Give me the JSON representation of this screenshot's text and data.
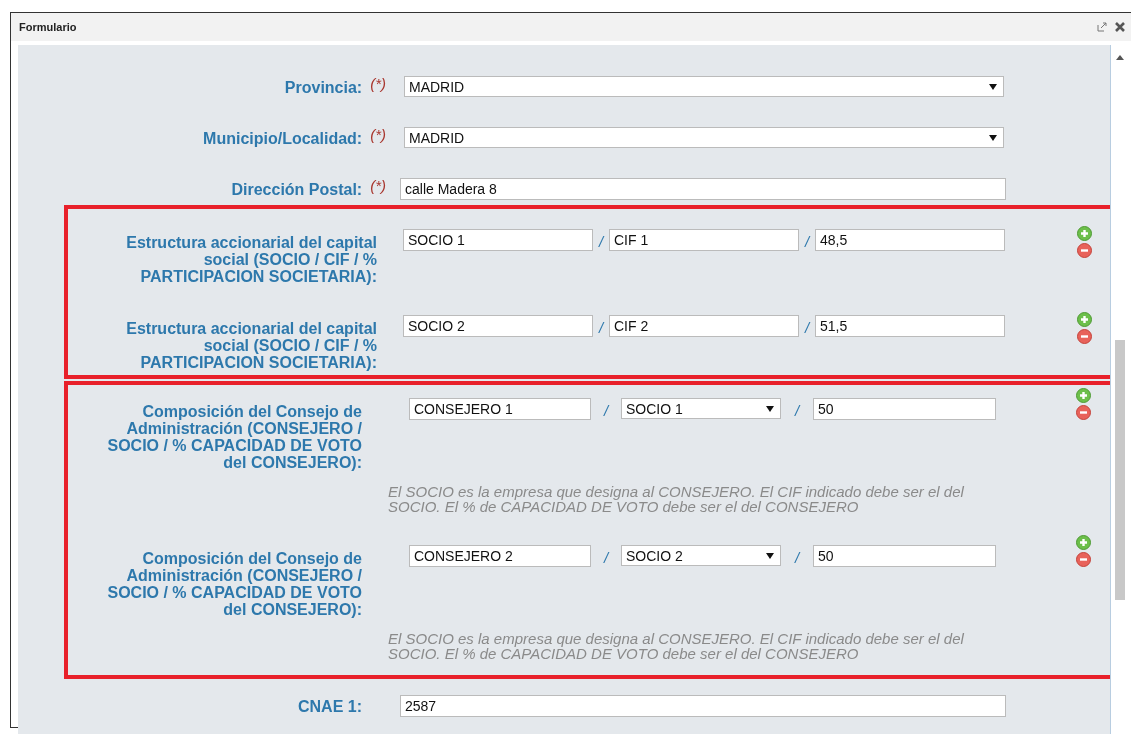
{
  "window": {
    "title": "Formulario"
  },
  "fields": [
    {
      "kind": "select",
      "label": "Provincia:",
      "required_mark": "(*)",
      "value": "MADRID"
    },
    {
      "kind": "select",
      "label": "Municipio/Localidad:",
      "required_mark": "(*)",
      "value": "MADRID"
    },
    {
      "kind": "text",
      "label": "Dirección Postal:",
      "required_mark": "(*)",
      "value": "calle Madera 8"
    }
  ],
  "shareholders": [
    {
      "label": "Estructura accionarial del capital social (SOCIO / CIF / % PARTICIPACION SOCIETARIA):",
      "partner": "SOCIO 1",
      "separators": [
        "/",
        "/"
      ],
      "cif": "CIF 1",
      "share": "48,5"
    },
    {
      "label": "Estructura accionarial del capital social (SOCIO / CIF / % PARTICIPACION SOCIETARIA):",
      "partner": "SOCIO 2",
      "separators": [
        "/",
        "/"
      ],
      "cif": "CIF 2",
      "share": "51,5"
    }
  ],
  "board": [
    {
      "label": "Composición del Consejo de Administración (CONSEJERO / SOCIO / % CAPACIDAD DE VOTO del CONSEJERO):",
      "director": "CONSEJERO 1",
      "separators": [
        "/",
        "/"
      ],
      "partner": "SOCIO 1",
      "vote": "50",
      "note": "El SOCIO es la empresa que designa al CONSEJERO. El CIF indicado debe ser el del SOCIO. El % de CAPACIDAD DE VOTO debe ser el del CONSEJERO"
    },
    {
      "label": "Composición del Consejo de Administración (CONSEJERO / SOCIO / % CAPACIDAD DE VOTO del CONSEJERO):",
      "director": "CONSEJERO 2",
      "separators": [
        "/",
        "/"
      ],
      "partner": "SOCIO 2",
      "vote": "50",
      "note": "El SOCIO es la empresa que designa al CONSEJERO. El CIF indicado debe ser el del SOCIO. El % de CAPACIDAD DE VOTO debe ser el del CONSEJERO"
    }
  ],
  "bottom_fields": [
    {
      "kind": "text",
      "label": "CNAE 1:",
      "value": "2587"
    }
  ]
}
